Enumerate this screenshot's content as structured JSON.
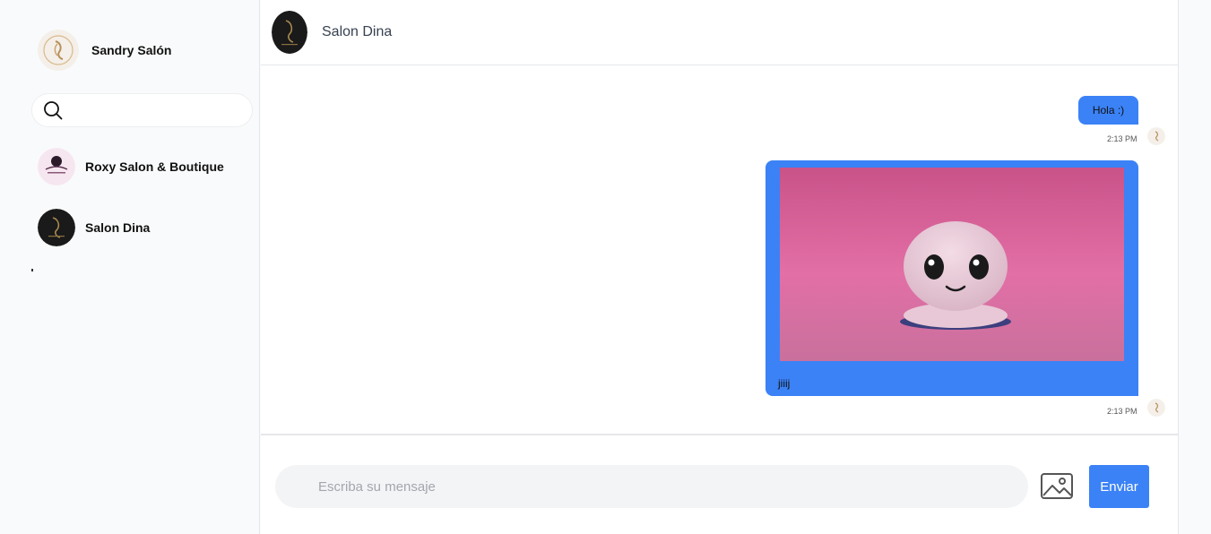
{
  "user": {
    "name": "Sandry Salón"
  },
  "search": {
    "placeholder": ""
  },
  "contacts": [
    {
      "name": "Roxy Salon & Boutique"
    },
    {
      "name": "Salon Dina"
    }
  ],
  "chat": {
    "title": "Salon Dina",
    "messages": [
      {
        "type": "text",
        "text": "Hola :)",
        "time": "2:13 PM"
      },
      {
        "type": "image",
        "caption": "jiiij",
        "time": "2:13 PM"
      }
    ]
  },
  "composer": {
    "placeholder": "Escriba su mensaje",
    "send_label": "Enviar",
    "image_icon": "image-icon"
  },
  "colors": {
    "accent": "#3b82f6",
    "sidebar_bg": "#f9fafb",
    "image_bg": "#d96aa0"
  }
}
